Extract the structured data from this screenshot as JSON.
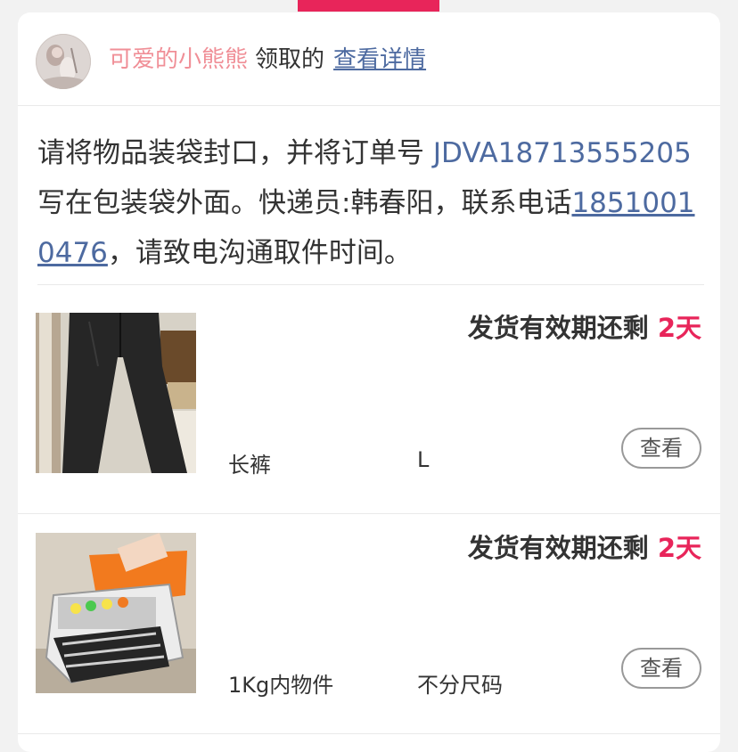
{
  "theme": {
    "accent": "#e8255a",
    "link": "#4d6aa0",
    "username": "#f08f97"
  },
  "claim": {
    "username": "可爱的小熊熊",
    "verb": "领取的",
    "detail_link": "查看详情"
  },
  "notice": {
    "prefix": "请将物品装袋封口，并将订单号 ",
    "order_no": "JDVA18713555205",
    "middle": " 写在包装袋外面。快递员:韩春阳，联系电话",
    "phone": "18510010476",
    "suffix": "，请致电沟通取件时间。"
  },
  "items": [
    {
      "deadline_label": "发货有效期还剩",
      "days": "2天",
      "name": "长裤",
      "size": "L",
      "view_label": "查看",
      "thumb_icon": "pants-photo"
    },
    {
      "deadline_label": "发货有效期还剩",
      "days": "2天",
      "name": "1Kg内物件",
      "size": "不分尺码",
      "view_label": "查看",
      "thumb_icon": "toy-truck-photo"
    }
  ]
}
